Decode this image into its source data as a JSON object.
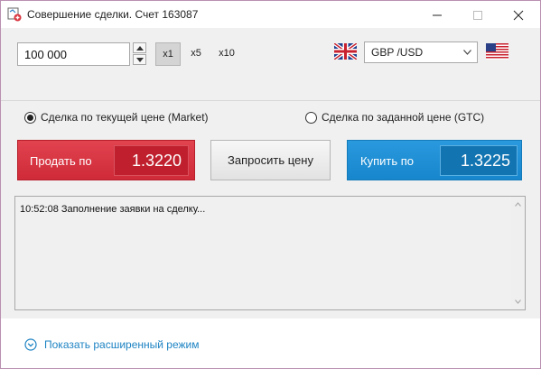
{
  "window": {
    "title": "Совершение сделки. Счет 163087"
  },
  "order": {
    "amount": "100 000",
    "multipliers": [
      "x1",
      "x5",
      "x10"
    ],
    "selected_multiplier": "x1",
    "pair": "GBP /USD"
  },
  "mode": {
    "market_label": "Сделка по текущей цене (Market)",
    "gtc_label": "Сделка по заданной цене (GTC)",
    "selected": "market"
  },
  "actions": {
    "sell_label": "Продать по",
    "sell_price": "1.3220",
    "quote_label": "Запросить цену",
    "buy_label": "Купить по",
    "buy_price": "1.3225"
  },
  "log": {
    "lines": [
      "10:52:08 Заполнение заявки на сделку..."
    ]
  },
  "footer": {
    "advanced_link": "Показать расширенный режим"
  },
  "colors": {
    "sell": "#d9343f",
    "buy": "#1e8fd6",
    "link": "#1d83c3"
  },
  "icons": {
    "app": "trade-app-icon",
    "gb_flag": "uk-flag-icon",
    "us_flag": "us-flag-icon",
    "expand": "chevron-circle-down-icon"
  }
}
